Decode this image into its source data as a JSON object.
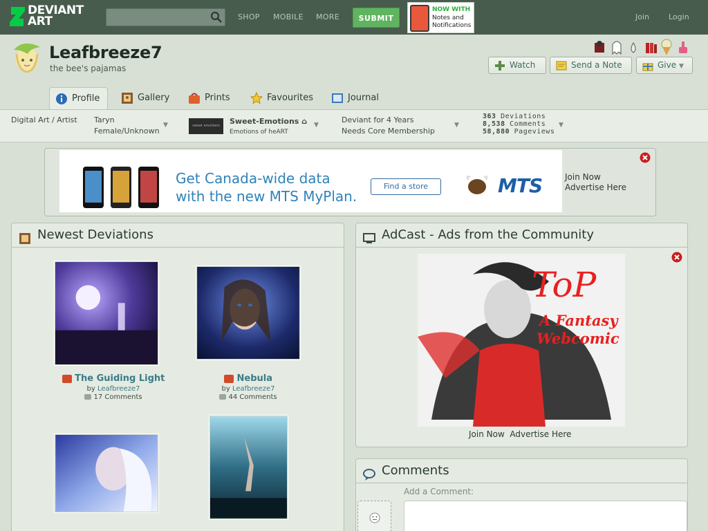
{
  "topbar": {
    "logo_line1": "DEVIANT",
    "logo_line2": "ART",
    "search_placeholder": "",
    "nav": [
      "SHOP",
      "MOBILE",
      "MORE"
    ],
    "submit_label": "SUBMIT",
    "promo_line1": "NOW WITH",
    "promo_line2": "Notes and Notifications",
    "join": "Join",
    "login": "Login",
    "bg_color": "#475c4d",
    "submit_color": "#60b460"
  },
  "profile": {
    "username": "Leafbreeze7",
    "tagline": "the bee's pajamas",
    "actions": {
      "watch": "Watch",
      "note": "Send a Note",
      "give": "Give"
    }
  },
  "tabs": [
    "Profile",
    "Gallery",
    "Prints",
    "Favourites",
    "Journal"
  ],
  "info": {
    "role": "Digital Art / Artist",
    "name": "Taryn",
    "gender": "Female/Unknown",
    "group_thumb_text": "sweet emotions",
    "group_name": "Sweet-Emotions",
    "group_tagline": "Emotions of heART",
    "member_since": "Deviant for 4 Years",
    "membership": "Needs Core Membership",
    "stats": [
      {
        "value": "363",
        "label": "Deviations"
      },
      {
        "value": "8,538",
        "label": "Comments"
      },
      {
        "value": "58,880",
        "label": "Pageviews"
      }
    ]
  },
  "ad": {
    "line1": "Get Canada-wide data",
    "line2": "with the new MTS MyPlan.",
    "button": "Find a store",
    "brand": "MTS",
    "join": "Join Now",
    "advertise": "Advertise Here"
  },
  "newest": {
    "title": "Newest Deviations",
    "items": [
      {
        "title": "The Guiding Light",
        "by_prefix": "by",
        "author": "Leafbreeze7",
        "comments": "17 Comments"
      },
      {
        "title": "Nebula",
        "by_prefix": "by",
        "author": "Leafbreeze7",
        "comments": "44 Comments"
      }
    ]
  },
  "adcast": {
    "title": "AdCast - Ads from the Community",
    "art_title": "ToP",
    "art_sub1": "A Fantasy",
    "art_sub2": "Webcomic",
    "join": "Join Now",
    "advertise": "Advertise Here"
  },
  "comments": {
    "title": "Comments",
    "add_label": "Add a Comment:"
  }
}
